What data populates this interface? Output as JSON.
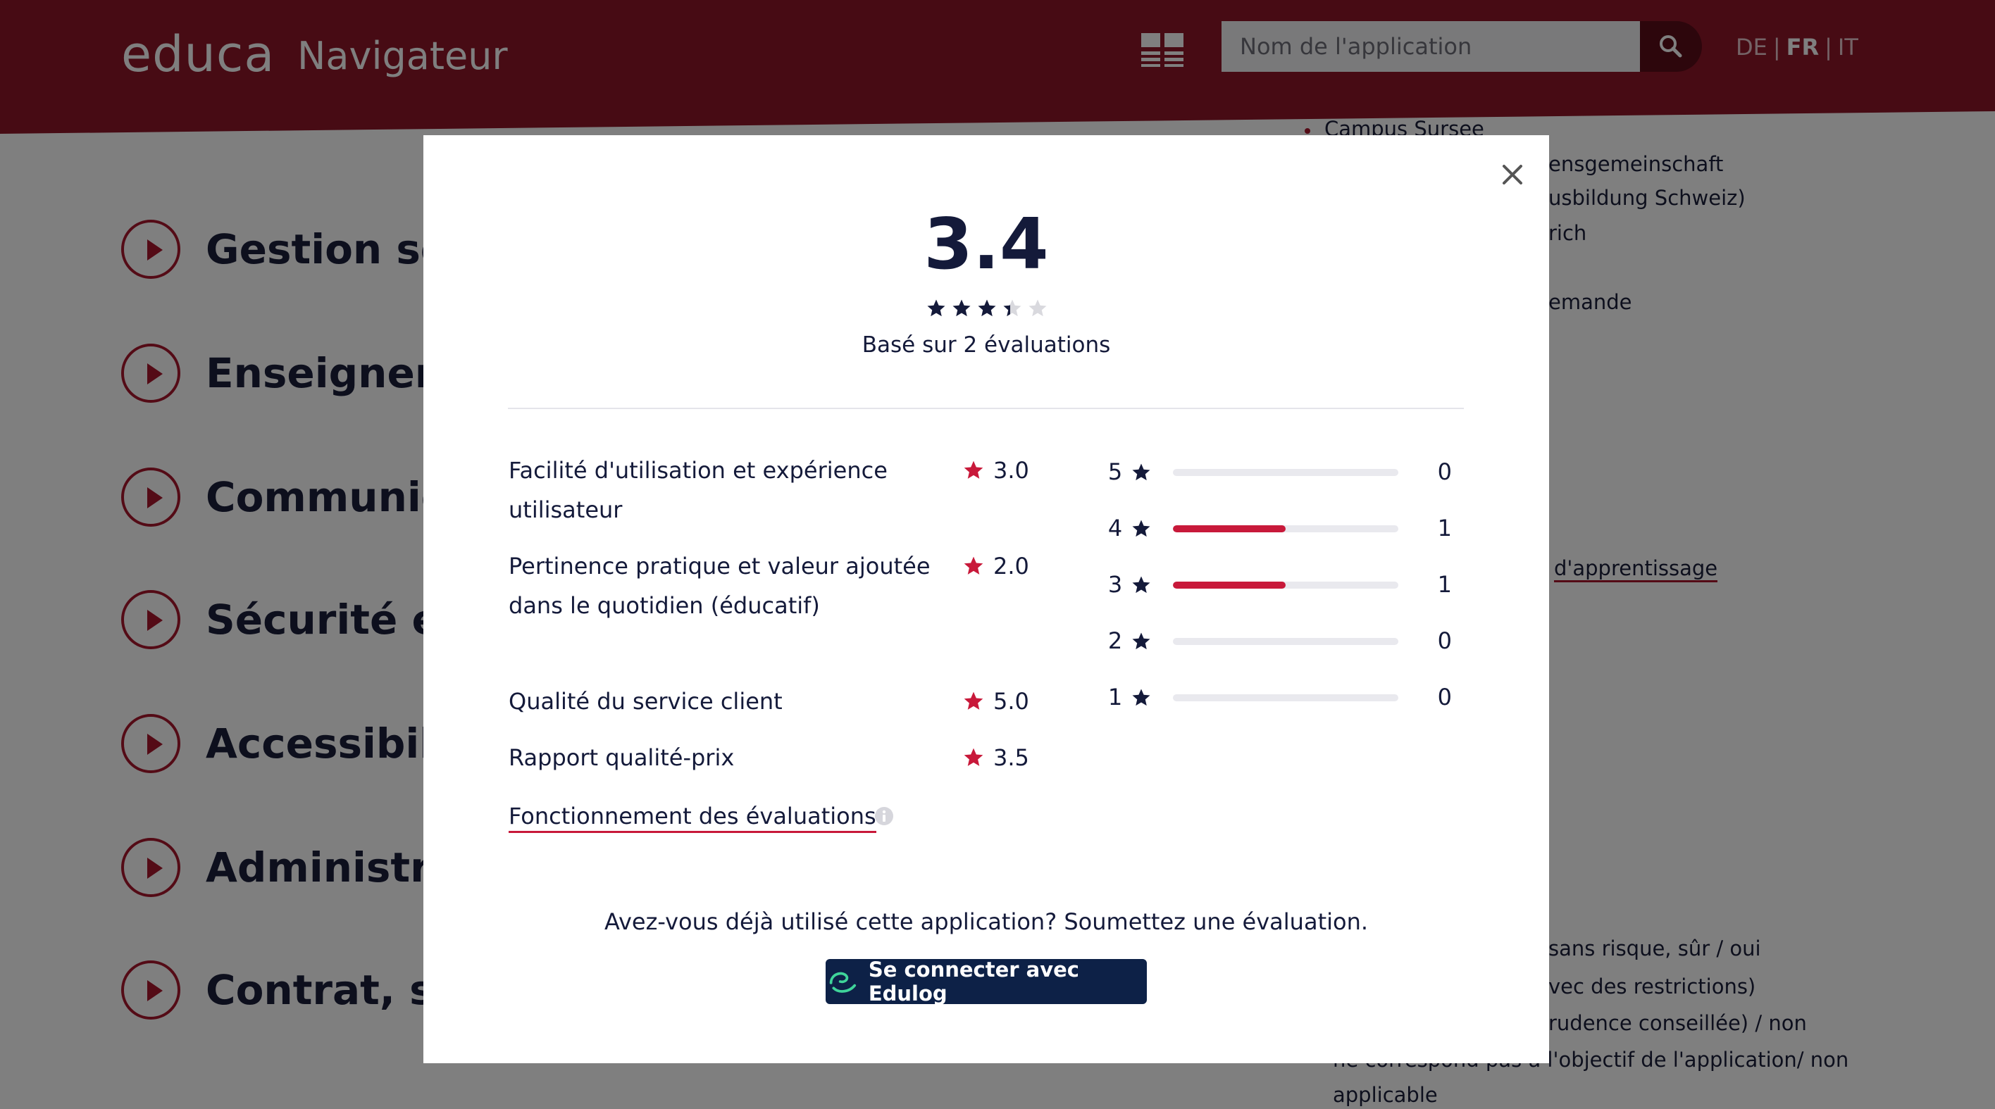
{
  "header": {
    "logo": "educa",
    "logo_sub": "Navigateur",
    "search_placeholder": "Nom de l'application",
    "languages": {
      "de": "DE",
      "fr": "FR",
      "it": "IT",
      "separator": "|",
      "active": "FR"
    }
  },
  "categories": [
    {
      "label": "Gestion sco"
    },
    {
      "label": "Enseigner e"
    },
    {
      "label": "Communica"
    },
    {
      "label": "Sécurité et"
    },
    {
      "label": "Accessibilit"
    },
    {
      "label": "Administrat"
    },
    {
      "label": "Contrat, su"
    }
  ],
  "background_right": {
    "item_1": "Campus Sursee",
    "item_2": "ensgemeinschaft",
    "item_3": "usbildung Schweiz)",
    "item_4": "rich",
    "item_5": "emande",
    "item_6": "d'apprentissage",
    "item_7": "sans risque, sûr / oui",
    "item_8": "vec des restrictions)",
    "item_9": "rudence conseillée) / non",
    "item_10": "ne correspond pas à l'objectif de l'application/ non",
    "item_11": "applicable"
  },
  "modal": {
    "score": "3.4",
    "rating_stars": 3.4,
    "based_on": "Basé sur 2 évaluations",
    "criteria": [
      {
        "label": "Facilité d'utilisation et expérience utilisateur",
        "value": "3.0"
      },
      {
        "label": "Pertinence pratique et valeur ajoutée dans le quotidien (éducatif)",
        "value": "2.0"
      },
      {
        "label": "Qualité du service client",
        "value": "5.0"
      },
      {
        "label": "Rapport qualité-prix",
        "value": "3.5"
      }
    ],
    "distribution": [
      {
        "stars": "5",
        "count": "0",
        "fraction": 0
      },
      {
        "stars": "4",
        "count": "1",
        "fraction": 0.5
      },
      {
        "stars": "3",
        "count": "1",
        "fraction": 0.5
      },
      {
        "stars": "2",
        "count": "0",
        "fraction": 0
      },
      {
        "stars": "1",
        "count": "0",
        "fraction": 0
      }
    ],
    "how_link": "Fonctionnement des évaluations",
    "prompt": "Avez-vous déjà utilisé cette application? Soumettez une évaluation.",
    "login_button": "Se connecter avec Edulog"
  },
  "colors": {
    "header": "#8f1629",
    "accent": "#c8193a",
    "navy": "#0d2147"
  },
  "icons": {
    "grid": "grid-view-icon",
    "search": "search-icon",
    "close": "close-icon",
    "star": "star-icon",
    "info": "info-icon",
    "edulog": "edulog-logo-icon"
  }
}
